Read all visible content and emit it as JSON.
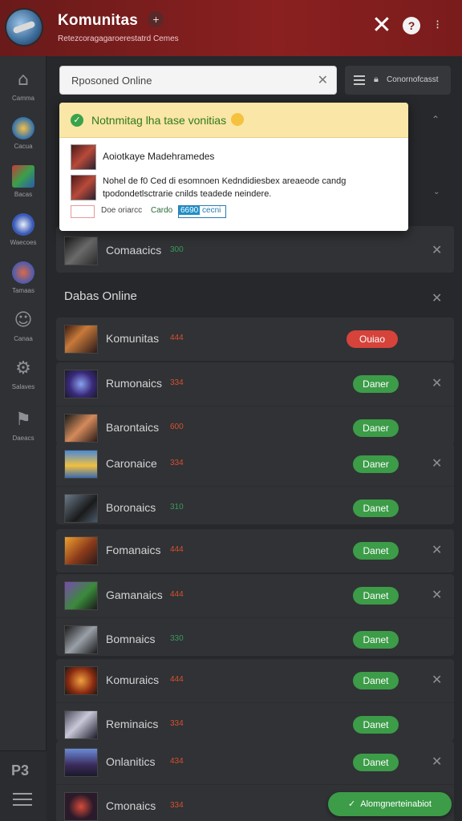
{
  "header": {
    "title": "Komunitas",
    "plus": "+",
    "subtitle": "Retezcoragagaroerestatrd Cemes",
    "close": "✕",
    "help": "?",
    "more": "⁝"
  },
  "rail": {
    "items": [
      {
        "label": "Camma"
      },
      {
        "label": "Cacua"
      },
      {
        "label": "Bacas"
      },
      {
        "label": "Waecoes"
      },
      {
        "label": "Tamaas"
      },
      {
        "label": "Canaa"
      },
      {
        "label": "Salaves"
      },
      {
        "label": "Daeacs"
      }
    ],
    "bottom_logo": "P3"
  },
  "search": {
    "value": "Rposoned Online",
    "clear": "✕"
  },
  "filter": {
    "label": "Conornofcasst"
  },
  "popup": {
    "title": "Notnmitag lha tase vonitias",
    "line1": "Aoiotkaye Madehramedes",
    "line2": "Nohel de f0 Ced di esomnoen Kedndidiesbex areaeode candg tpodondetlsctrarie cnilds teadede neindere.",
    "link1": "Doe oriarcc",
    "link2": "Cardo",
    "select_highlight": "6690",
    "select_rest": "cecni"
  },
  "top_item": {
    "name": "Comaacics",
    "count": "300"
  },
  "section": {
    "title": "Dabas Online"
  },
  "groups": [
    [
      {
        "name": "Komunitas",
        "count": "444",
        "count_color": "red",
        "button": "Ouiao",
        "button_style": "red",
        "x": false,
        "thumb": "t1"
      }
    ],
    [
      {
        "name": "Rumonaics",
        "count": "334",
        "count_color": "red",
        "button": "Daner",
        "button_style": "green",
        "x": true,
        "thumb": "t2"
      },
      {
        "name": "Barontaics",
        "count": "600",
        "count_color": "red",
        "button": "Daner",
        "button_style": "green",
        "x": false,
        "thumb": "t3"
      }
    ],
    [
      {
        "name": "Caronaice",
        "count": "334",
        "count_color": "red",
        "button": "Daner",
        "button_style": "green",
        "x": true,
        "thumb": "t4"
      },
      {
        "name": "Boronaics",
        "count": "310",
        "count_color": "green",
        "button": "Danet",
        "button_style": "green",
        "x": false,
        "thumb": "t5"
      }
    ],
    [
      {
        "name": "Fomanaics",
        "count": "444",
        "count_color": "red",
        "button": "Danet",
        "button_style": "green",
        "x": true,
        "thumb": "t6"
      }
    ],
    [
      {
        "name": "Gamanaics",
        "count": "444",
        "count_color": "red",
        "button": "Danet",
        "button_style": "green",
        "x": true,
        "thumb": "t7"
      },
      {
        "name": "Bomnaics",
        "count": "330",
        "count_color": "green",
        "button": "Danet",
        "button_style": "green",
        "x": false,
        "thumb": "t8"
      }
    ],
    [
      {
        "name": "Komuraics",
        "count": "444",
        "count_color": "red",
        "button": "Danet",
        "button_style": "green",
        "x": true,
        "thumb": "t9"
      },
      {
        "name": "Reminaics",
        "count": "334",
        "count_color": "red",
        "button": "Danet",
        "button_style": "green",
        "x": false,
        "thumb": "t10"
      }
    ],
    [
      {
        "name": "Onlanitics",
        "count": "434",
        "count_color": "red",
        "button": "Danet",
        "button_style": "green",
        "x": true,
        "thumb": "t11"
      },
      {
        "name": "Cmonaics",
        "count": "334",
        "count_color": "red",
        "button": null,
        "button_style": "",
        "x": false,
        "thumb": "t12"
      }
    ]
  ],
  "toast": {
    "check": "✓",
    "text": "Alomgnerteinabiot"
  },
  "colors": {
    "header": "#7a1c1c",
    "accent_green": "#3c9c48",
    "accent_red": "#d5433b",
    "popup_banner": "#fae6a6"
  }
}
